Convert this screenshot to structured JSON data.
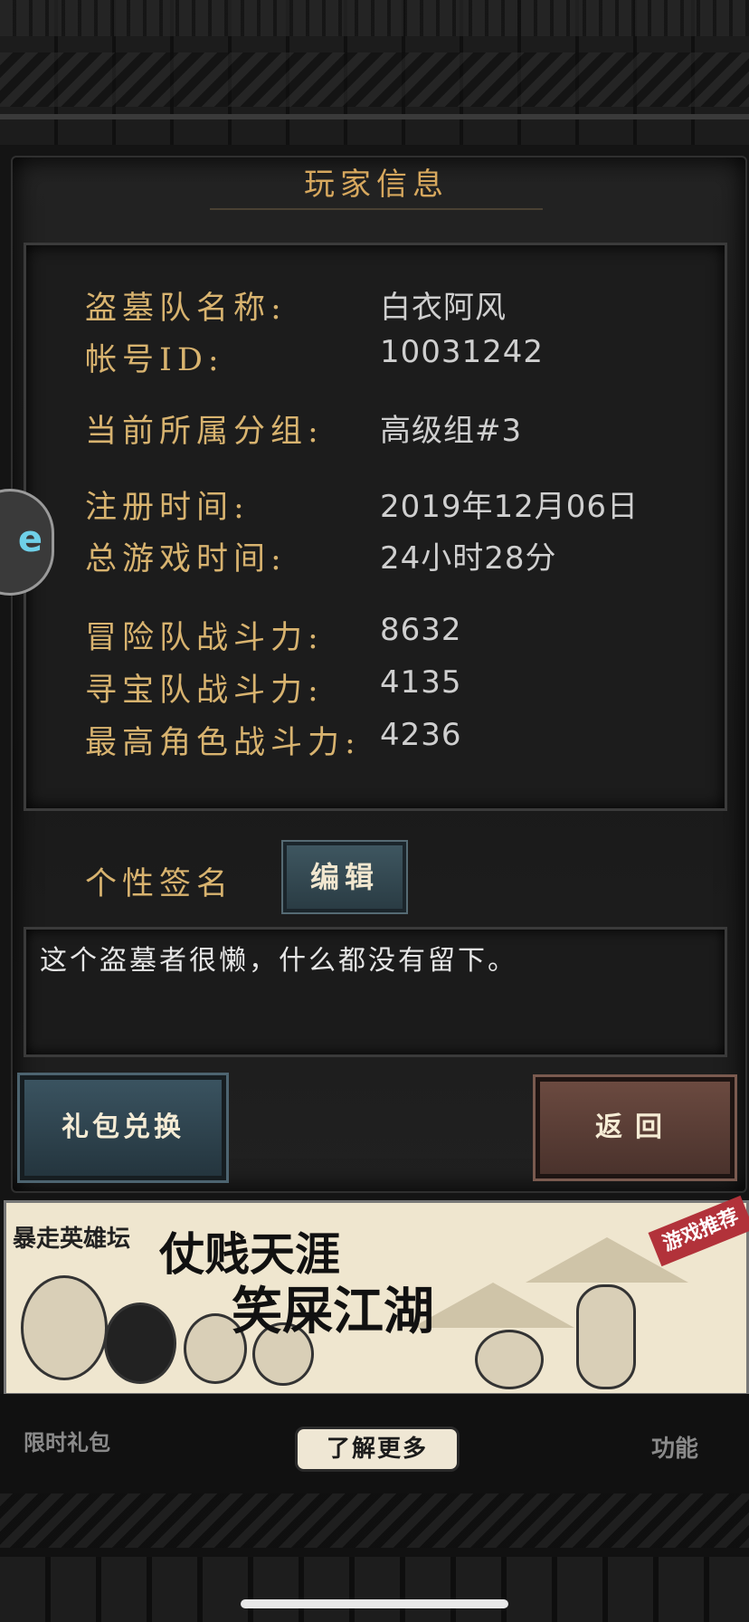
{
  "panel": {
    "title": "玩家信息"
  },
  "info": [
    {
      "label": "盗墓队名称:",
      "value": "白衣阿风"
    },
    {
      "label": "帐号ID:",
      "value": "10031242"
    },
    {
      "label": "当前所属分组:",
      "value": "高级组#3"
    },
    {
      "label": "注册时间:",
      "value": "2019年12月06日"
    },
    {
      "label": "总游戏时间:",
      "value": "24小时28分"
    },
    {
      "label": "冒险队战斗力:",
      "value": "8632"
    },
    {
      "label": "寻宝队战斗力:",
      "value": "4135"
    },
    {
      "label": "最高角色战斗力:",
      "value": "4236"
    }
  ],
  "signature": {
    "label": "个性签名",
    "edit_label": "编辑",
    "text": "这个盗墓者很懒，什么都没有留下。"
  },
  "buttons": {
    "gift_exchange": "礼包兑换",
    "back": "返回"
  },
  "ad": {
    "logo": "暴走英雄坛",
    "line1": "仗贱天涯",
    "line2": "笑屎江湖",
    "tag": "游戏推荐",
    "more": "了解更多"
  },
  "nav": {
    "left": "限时礼包",
    "right": "功能"
  },
  "side_float": {
    "icon": "floating-ball-icon"
  },
  "colors": {
    "label": "#d8b36f",
    "value": "#cfcfcf",
    "title": "#d7a85e",
    "gift_btn": "#3a5360",
    "back_btn": "#6b4a40"
  }
}
